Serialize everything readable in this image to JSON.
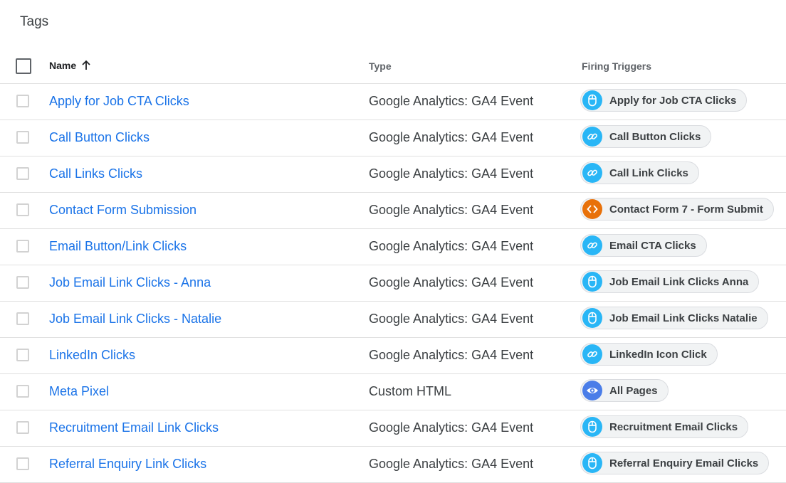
{
  "page": {
    "title": "Tags"
  },
  "table": {
    "headers": {
      "name": "Name",
      "type": "Type",
      "triggers": "Firing Triggers"
    },
    "rows": [
      {
        "name": "Apply for Job CTA Clicks",
        "type": "Google Analytics: GA4 Event",
        "trigger": "Apply for Job CTA Clicks",
        "trigger_icon": "mouse-click-icon",
        "icon_color": "#29b6f6"
      },
      {
        "name": "Call Button Clicks",
        "type": "Google Analytics: GA4 Event",
        "trigger": "Call Button Clicks",
        "trigger_icon": "link-icon",
        "icon_color": "#29b6f6"
      },
      {
        "name": "Call Links Clicks",
        "type": "Google Analytics: GA4 Event",
        "trigger": "Call Link Clicks",
        "trigger_icon": "link-icon",
        "icon_color": "#29b6f6"
      },
      {
        "name": "Contact Form Submission",
        "type": "Google Analytics: GA4 Event",
        "trigger": "Contact Form 7 - Form Submit",
        "trigger_icon": "code-icon",
        "icon_color": "#e8710a"
      },
      {
        "name": "Email Button/Link Clicks",
        "type": "Google Analytics: GA4 Event",
        "trigger": "Email CTA Clicks",
        "trigger_icon": "link-icon",
        "icon_color": "#29b6f6"
      },
      {
        "name": "Job Email Link Clicks - Anna",
        "type": "Google Analytics: GA4 Event",
        "trigger": "Job Email Link Clicks Anna",
        "trigger_icon": "mouse-click-icon",
        "icon_color": "#29b6f6"
      },
      {
        "name": "Job Email Link Clicks - Natalie",
        "type": "Google Analytics: GA4 Event",
        "trigger": "Job Email Link Clicks Natalie",
        "trigger_icon": "mouse-click-icon",
        "icon_color": "#29b6f6"
      },
      {
        "name": "LinkedIn Clicks",
        "type": "Google Analytics: GA4 Event",
        "trigger": "LinkedIn Icon Click",
        "trigger_icon": "link-icon",
        "icon_color": "#29b6f6"
      },
      {
        "name": "Meta Pixel",
        "type": "Custom HTML",
        "trigger": "All Pages",
        "trigger_icon": "eye-icon",
        "icon_color": "#4a7de8"
      },
      {
        "name": "Recruitment Email Link Clicks",
        "type": "Google Analytics: GA4 Event",
        "trigger": "Recruitment Email Clicks",
        "trigger_icon": "mouse-click-icon",
        "icon_color": "#29b6f6"
      },
      {
        "name": "Referral Enquiry Link Clicks",
        "type": "Google Analytics: GA4 Event",
        "trigger": "Referral Enquiry Email Clicks",
        "trigger_icon": "mouse-click-icon",
        "icon_color": "#29b6f6"
      }
    ]
  }
}
